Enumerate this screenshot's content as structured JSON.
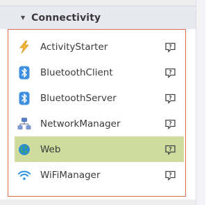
{
  "palette": {
    "section": "Connectivity",
    "components": [
      {
        "name": "ActivityStarter",
        "icon": "lightning-bolt-icon",
        "selected": false
      },
      {
        "name": "BluetoothClient",
        "icon": "bluetooth-icon",
        "selected": false
      },
      {
        "name": "BluetoothServer",
        "icon": "bluetooth-icon",
        "selected": false
      },
      {
        "name": "NetworkManager",
        "icon": "network-icon",
        "selected": false
      },
      {
        "name": "Web",
        "icon": "globe-icon",
        "selected": true
      },
      {
        "name": "WiFiManager",
        "icon": "wifi-icon",
        "selected": false
      }
    ]
  },
  "colors": {
    "selected_row": "#cfdc9e",
    "drawer_border": "#e26e50",
    "section_header_bg": "#e8e8f0"
  }
}
